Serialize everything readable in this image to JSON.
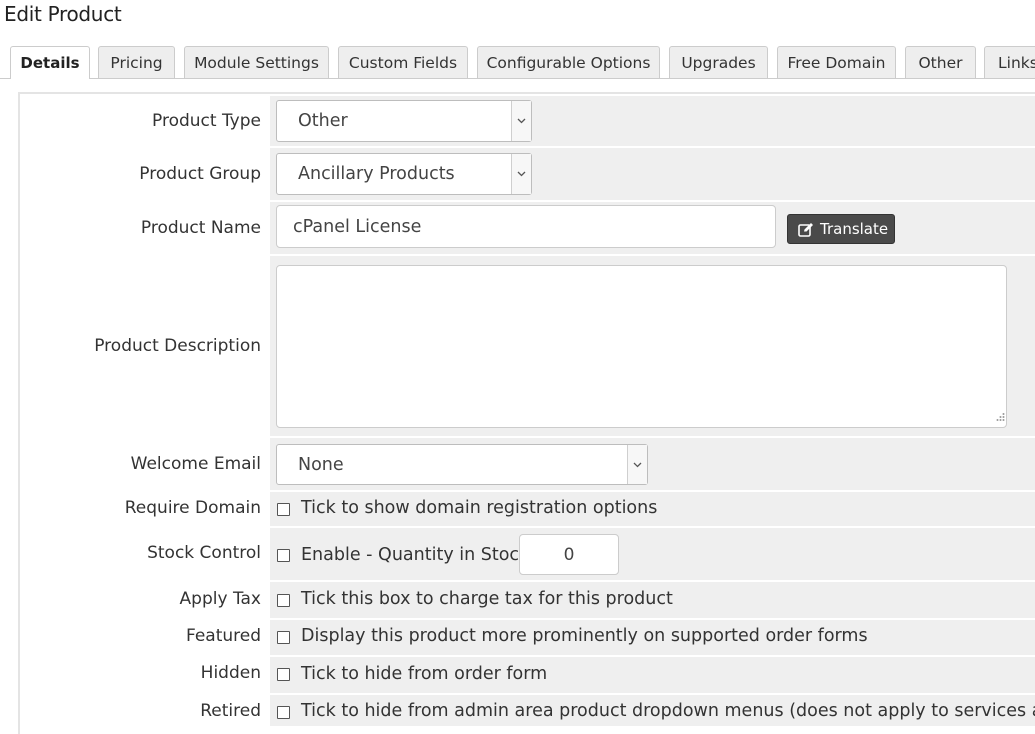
{
  "page": {
    "title": "Edit Product"
  },
  "tabs": [
    {
      "label": "Details",
      "active": true
    },
    {
      "label": "Pricing"
    },
    {
      "label": "Module Settings"
    },
    {
      "label": "Custom Fields"
    },
    {
      "label": "Configurable Options"
    },
    {
      "label": "Upgrades"
    },
    {
      "label": "Free Domain"
    },
    {
      "label": "Other"
    },
    {
      "label": "Links"
    }
  ],
  "form": {
    "product_type": {
      "label": "Product Type",
      "value": "Other"
    },
    "product_group": {
      "label": "Product Group",
      "value": "Ancillary Products"
    },
    "product_name": {
      "label": "Product Name",
      "value": "cPanel License",
      "translate_label": "Translate"
    },
    "product_description": {
      "label": "Product Description",
      "value": ""
    },
    "welcome_email": {
      "label": "Welcome Email",
      "value": "None"
    },
    "require_domain": {
      "label": "Require Domain",
      "text": "Tick to show domain registration options",
      "checked": false
    },
    "stock_control": {
      "label": "Stock Control",
      "text": "Enable - Quantity in Stock:",
      "checked": false,
      "quantity": "0"
    },
    "apply_tax": {
      "label": "Apply Tax",
      "text": "Tick this box to charge tax for this product",
      "checked": false
    },
    "featured": {
      "label": "Featured",
      "text": "Display this product more prominently on supported order forms",
      "checked": false
    },
    "hidden": {
      "label": "Hidden",
      "text": "Tick to hide from order form",
      "checked": false
    },
    "retired": {
      "label": "Retired",
      "text": "Tick to hide from admin area product dropdown menus (does not apply to services already",
      "checked": false
    }
  },
  "icons": {
    "translate": "edit-icon",
    "select_caret": "chevron-down-icon",
    "resize": "resize-grip-icon"
  }
}
